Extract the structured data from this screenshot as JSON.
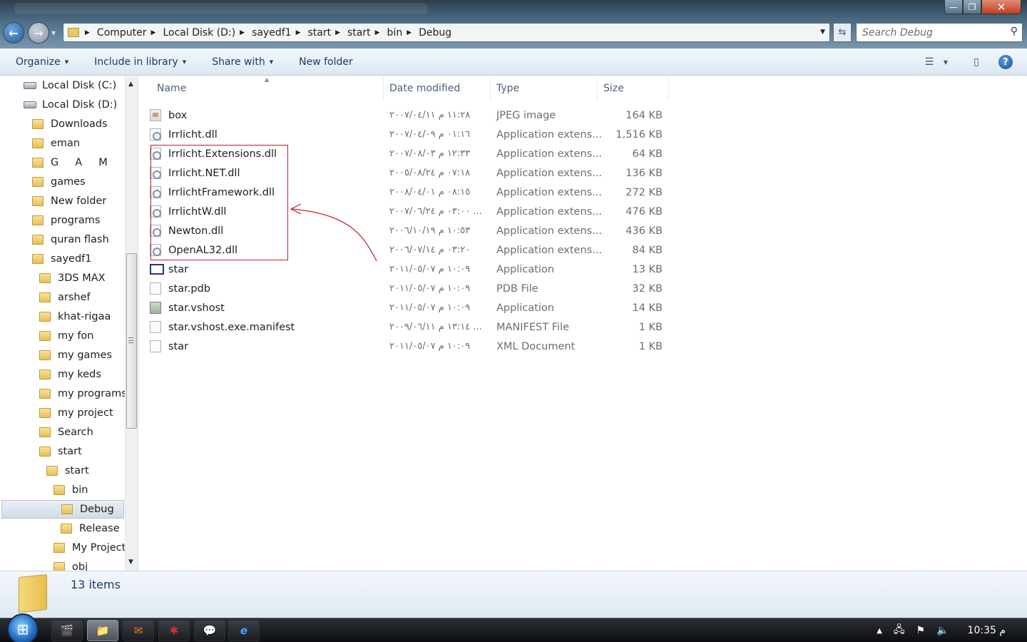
{
  "window": {
    "controls": {
      "minimize": "—",
      "maximize": "❐",
      "close": "✕"
    }
  },
  "address": {
    "crumbs": [
      "Computer",
      "Local Disk (D:)",
      "sayedf1",
      "start",
      "start",
      "bin",
      "Debug"
    ]
  },
  "search": {
    "placeholder": "Search Debug"
  },
  "toolbar": {
    "organize": "Organize",
    "include_in_library": "Include in library",
    "share_with": "Share with",
    "new_folder": "New folder"
  },
  "nav": {
    "items": [
      {
        "label": "Local Disk (C:)",
        "kind": "drive"
      },
      {
        "label": "Local Disk (D:)",
        "kind": "drive"
      },
      {
        "label": "Downloads",
        "kind": "folder"
      },
      {
        "label": "eman",
        "kind": "folder"
      },
      {
        "label": "G     A     M",
        "kind": "folder"
      },
      {
        "label": "games",
        "kind": "folder"
      },
      {
        "label": "New folder",
        "kind": "folder"
      },
      {
        "label": "programs",
        "kind": "folder"
      },
      {
        "label": "quran flash",
        "kind": "folder"
      },
      {
        "label": "sayedf1",
        "kind": "folder"
      },
      {
        "label": "3DS MAX",
        "kind": "folder"
      },
      {
        "label": "arshef",
        "kind": "folder"
      },
      {
        "label": "khat-rigaa",
        "kind": "folder"
      },
      {
        "label": "my fon",
        "kind": "folder"
      },
      {
        "label": "my games",
        "kind": "folder"
      },
      {
        "label": "my keds",
        "kind": "folder"
      },
      {
        "label": "my programs",
        "kind": "folder"
      },
      {
        "label": "my project",
        "kind": "folder"
      },
      {
        "label": "Search",
        "kind": "folder"
      },
      {
        "label": "start",
        "kind": "folder"
      },
      {
        "label": "start",
        "kind": "folder"
      },
      {
        "label": "bin",
        "kind": "folder"
      },
      {
        "label": "Debug",
        "kind": "folder",
        "selected": true
      },
      {
        "label": "Release",
        "kind": "folder"
      },
      {
        "label": "My Project",
        "kind": "folder"
      },
      {
        "label": "obj",
        "kind": "folder"
      }
    ]
  },
  "columns": {
    "name": "Name",
    "date": "Date modified",
    "type": "Type",
    "size": "Size"
  },
  "files": [
    {
      "name": "box",
      "date": "١١:٢٨ م ٢٠٠٧/٠٤/١١",
      "type": "JPEG image",
      "size": "164 KB",
      "icon": "image-icon"
    },
    {
      "name": "Irrlicht.dll",
      "date": "٠١:١٦ م ٢٠٠٧/٠٤/٠٩",
      "type": "Application extens...",
      "size": "1,516 KB",
      "icon": "dll-icon"
    },
    {
      "name": "Irrlicht.Extensions.dll",
      "date": "١٢:٣٣ م ٢٠٠٧/٠٨/٠٣",
      "type": "Application extens...",
      "size": "64 KB",
      "icon": "dll-icon"
    },
    {
      "name": "Irrlicht.NET.dll",
      "date": "٠٧:١٨ م ٢٠٠٥/٠٨/٢٤",
      "type": "Application extens...",
      "size": "136 KB",
      "icon": "dll-icon"
    },
    {
      "name": "IrrlichtFramework.dll",
      "date": "٠٨:١٥ م ٢٠٠٨/٠٤/٠١",
      "type": "Application extens...",
      "size": "272 KB",
      "icon": "dll-icon"
    },
    {
      "name": "IrrlichtW.dll",
      "date": "... ٠٣:٠٠ م ٢٠٠٧/٠٦/٢٤",
      "type": "Application extens...",
      "size": "476 KB",
      "icon": "dll-icon"
    },
    {
      "name": "Newton.dll",
      "date": "١٠:٥٣ م ٢٠٠٦/١٠/١٩",
      "type": "Application extens...",
      "size": "436 KB",
      "icon": "dll-icon"
    },
    {
      "name": "OpenAL32.dll",
      "date": "٠٣:٢٠ م ٢٠٠٦/٠٧/١٤",
      "type": "Application extens...",
      "size": "84 KB",
      "icon": "dll-icon"
    },
    {
      "name": "star",
      "date": "١٠:٠٩ م ٢٠١١/٠٥/٠٧",
      "type": "Application",
      "size": "13 KB",
      "icon": "app-icon"
    },
    {
      "name": "star.pdb",
      "date": "١٠:٠٩ م ٢٠١١/٠٥/٠٧",
      "type": "PDB File",
      "size": "32 KB",
      "icon": "file-icon"
    },
    {
      "name": "star.vshost",
      "date": "١٠:٠٩ م ٢٠١١/٠٥/٠٧",
      "type": "Application",
      "size": "14 KB",
      "icon": "app-icon"
    },
    {
      "name": "star.vshost.exe.manifest",
      "date": "... ١٣:١٤ م ٢٠٠٩/٠٦/١١",
      "type": "MANIFEST File",
      "size": "1 KB",
      "icon": "file-icon"
    },
    {
      "name": "star",
      "date": "١٠:٠٩ م ٢٠١١/٠٥/٠٧",
      "type": "XML Document",
      "size": "1 KB",
      "icon": "file-icon"
    }
  ],
  "details": {
    "count": "13 items"
  },
  "taskbar": {
    "clock": "10:35 م"
  },
  "colors": {
    "annotation": "#c0202a",
    "accent": "#1e395b"
  }
}
